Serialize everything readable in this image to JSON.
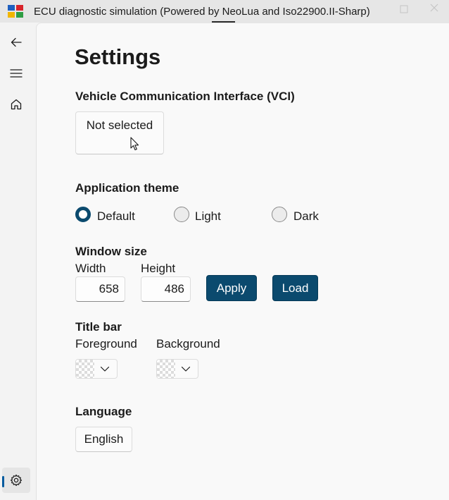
{
  "window": {
    "title": "ECU diagnostic simulation (Powered by NeoLua and Iso22900.II-Sharp)",
    "maximize_icon": "maximize-icon",
    "close_icon": "close-icon"
  },
  "nav": {
    "back_icon": "back-arrow-icon",
    "menu_icon": "hamburger-menu-icon",
    "home_icon": "home-icon",
    "settings_icon": "gear-icon",
    "selected": "settings"
  },
  "page": {
    "title": "Settings"
  },
  "vci": {
    "heading": "Vehicle Communication Interface (VCI)",
    "button_label": "Not selected"
  },
  "theme": {
    "heading": "Application theme",
    "options": [
      {
        "label": "Default",
        "checked": true
      },
      {
        "label": "Light",
        "checked": false
      },
      {
        "label": "Dark",
        "checked": false
      }
    ]
  },
  "window_size": {
    "heading": "Window size",
    "width_label": "Width",
    "height_label": "Height",
    "width_value": "658",
    "height_value": "486",
    "apply_label": "Apply",
    "load_label": "Load"
  },
  "title_bar": {
    "heading": "Title bar",
    "foreground_label": "Foreground",
    "background_label": "Background"
  },
  "language": {
    "heading": "Language",
    "value": "English"
  },
  "colors": {
    "accent": "#0b4a6e",
    "nav_indicator": "#005a9e"
  }
}
